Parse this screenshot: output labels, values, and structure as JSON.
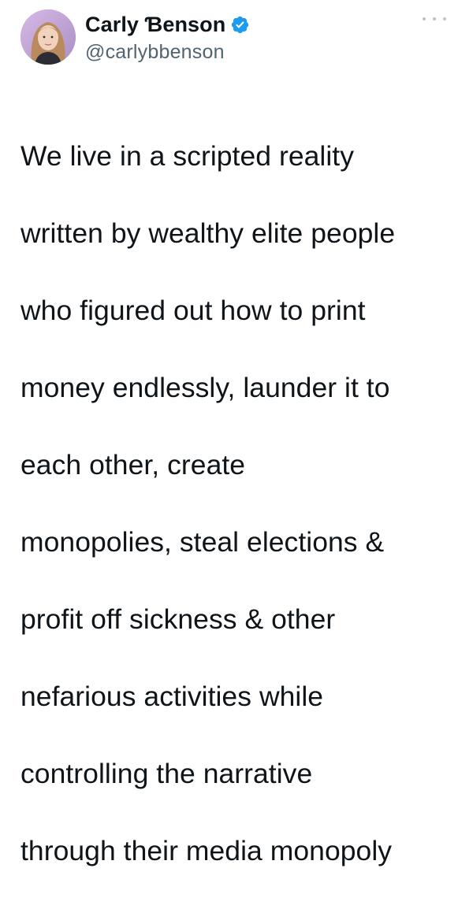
{
  "author": {
    "display_name": "Carly Ɓenson",
    "handle": "@carlybbenson",
    "verified": true
  },
  "tweet": {
    "text_lines": [
      "We live in a scripted reality",
      "written by wealthy elite people",
      "who figured out how to print",
      "money endlessly, launder it to",
      "each other, create",
      "monopolies, steal elections &",
      "profit off sickness & other",
      "nefarious activities while",
      "controlling the narrative",
      "through their media monopoly"
    ]
  },
  "icons": {
    "verified": "verified-badge-icon",
    "more": "more-options-icon"
  },
  "colors": {
    "verified_blue": "#1d9bf0",
    "secondary_text": "#536471",
    "primary_text": "#0f1419"
  }
}
